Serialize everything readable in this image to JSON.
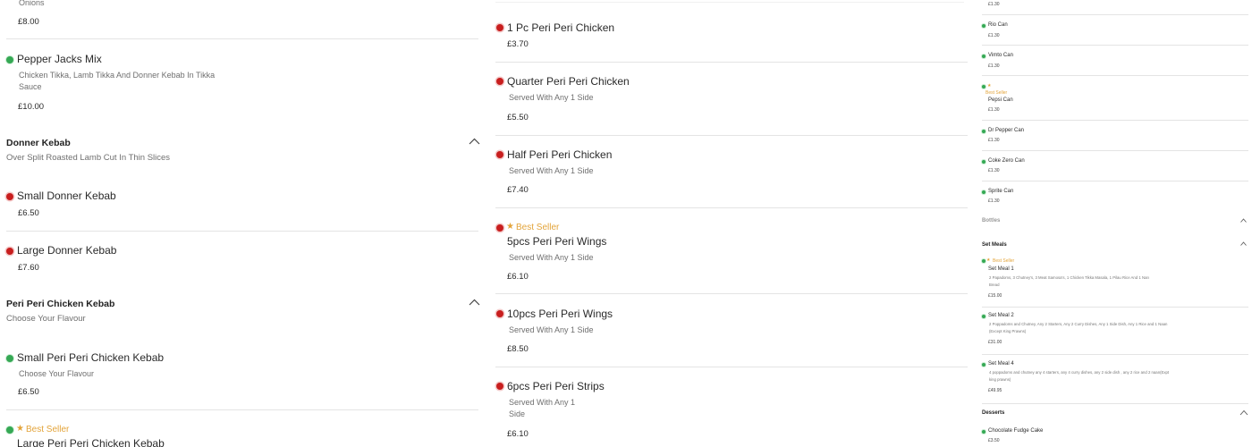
{
  "left_column": {
    "top_partial": {
      "desc": "Onions",
      "price": "£8.00"
    },
    "pepper_jacks": {
      "name": "Pepper Jacks Mix",
      "desc_line1": "Chicken Tikka, Lamb Tikka And Donner Kebab In Tikka",
      "desc_line2": "Sauce",
      "price": "£10.00"
    },
    "donner_category": {
      "title": "Donner Kebab",
      "subtitle": "Over Split Roasted Lamb Cut In Thin Slices"
    },
    "small_donner": {
      "name": "Small Donner Kebab",
      "price": "£6.50"
    },
    "large_donner": {
      "name": "Large Donner Kebab",
      "price": "£7.60"
    },
    "peri_category": {
      "title": "Peri Peri Chicken Kebab",
      "subtitle": "Choose Your Flavour"
    },
    "small_peri": {
      "name": "Small Peri Peri Chicken Kebab",
      "desc": "Choose Your Flavour",
      "price": "£6.50"
    },
    "large_peri": {
      "badge": "Best Seller",
      "name": "Large Peri Peri Chicken Kebab"
    }
  },
  "middle_column": {
    "items": [
      {
        "name": "1 Pc Peri Peri Chicken",
        "price": "£3.70"
      },
      {
        "name": "Quarter Peri Peri Chicken",
        "desc": "Served With Any 1 Side",
        "price": "£5.50"
      },
      {
        "name": "Half Peri Peri Chicken",
        "desc": "Served With Any 1 Side",
        "price": "£7.40"
      },
      {
        "badge": "Best Seller",
        "name": "5pcs Peri Peri Wings",
        "desc": "Served With Any 1 Side",
        "price": "£6.10"
      },
      {
        "name": "10pcs Peri Peri Wings",
        "desc": "Served With Any 1 Side",
        "price": "£8.50"
      },
      {
        "name": "6pcs Peri Peri Strips",
        "desc_line1": "Served With Any 1",
        "desc_line2": "Side",
        "price": "£6.10"
      }
    ]
  },
  "right_column": {
    "top_price": "£1.30",
    "drinks": [
      {
        "name": "Rio Can",
        "price": "£1.30"
      },
      {
        "name": "Vimto Can",
        "price": "£1.30"
      },
      {
        "badge": "Best Seller",
        "name": "Pepsi Can",
        "price": "£1.30"
      },
      {
        "name": "Dr Pepper Can",
        "price": "£1.30"
      },
      {
        "name": "Coke Zero Can",
        "price": "£1.30"
      },
      {
        "name": "Sprite Can",
        "price": "£1.30"
      }
    ],
    "bottles_category": "Bottles",
    "set_meals_category": "Set Meals",
    "set_meals": [
      {
        "badge": "Best Seller",
        "name": "Set Meal 1",
        "desc_line1": "2 Papadoms, 3 Chutney's, 3 Meat Samosa's, 1 Chicken Tikka Masala, 1 Pilau Rice And 1 Nan",
        "desc_line2": "Bread",
        "price": "£15.00"
      },
      {
        "name": "Set Meal 2",
        "desc_line1": "2 Poppadoms and Chutney, Any 2 Starters, Any 2 Curry Dishes, Any 1 Side Dish, Any 1 Rice and 1 Naan",
        "desc_line2": "(Except King Prawns)",
        "price": "£31.00"
      },
      {
        "name": "Set Meal 4",
        "desc_line1": "4 poppadoms and chutney any 4 starters, any 4 curry dishes, any 2 side dish , any 2 rice and 2 naan(Expt",
        "desc_line2": "king prawns)",
        "price": "£49.95"
      }
    ],
    "desserts_category": "Desserts",
    "desserts": [
      {
        "name": "Chocolate Fudge Cake",
        "price": "£3.50"
      }
    ]
  }
}
